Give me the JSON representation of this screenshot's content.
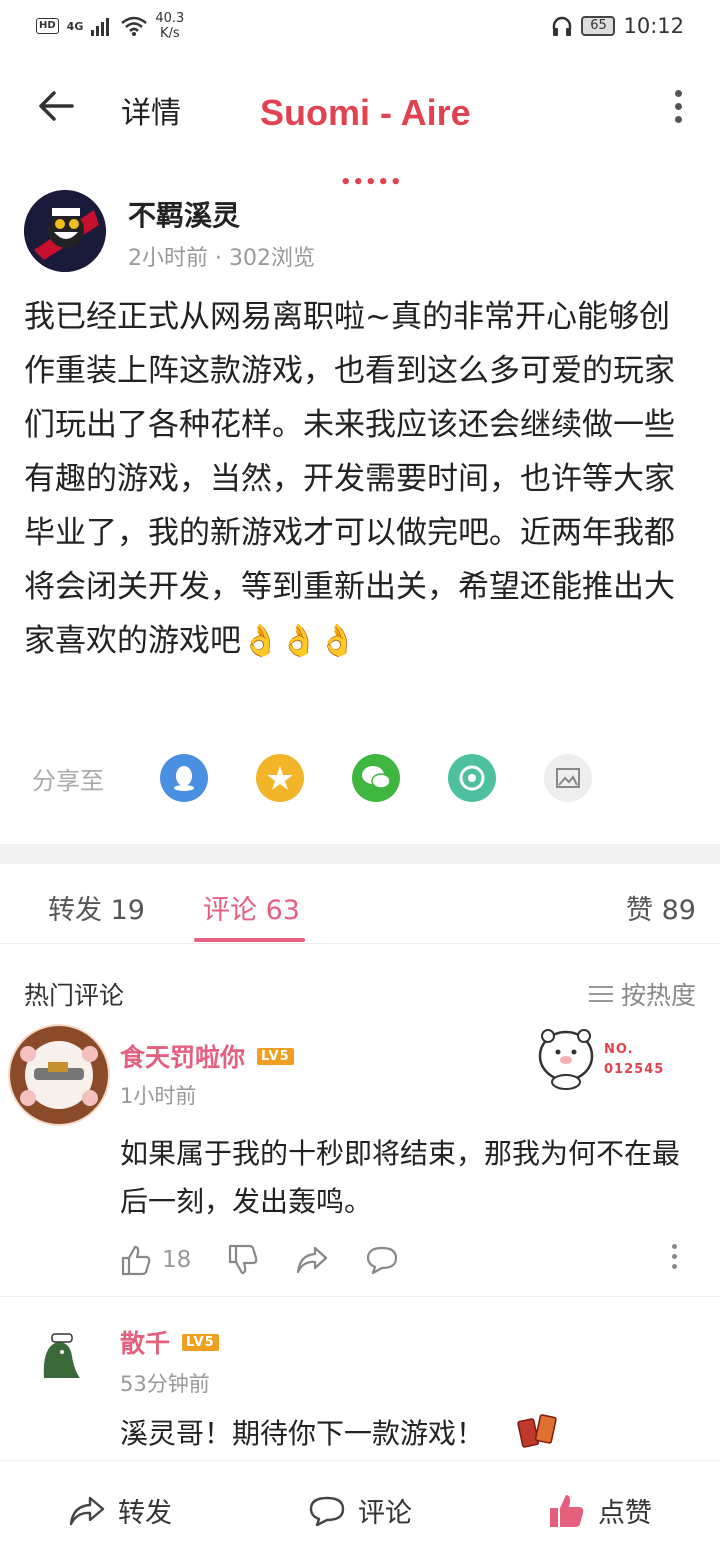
{
  "status_bar": {
    "hd": "HD",
    "signal": "4G",
    "speed_value": "40.3",
    "speed_unit": "K/s",
    "battery": "65",
    "time": "10:12"
  },
  "header": {
    "title": "详情",
    "watermark": "Suomi - Aire",
    "dots": "•••••"
  },
  "post": {
    "author": "不羁溪灵",
    "time": "2小时前",
    "separator": "·",
    "views": "302浏览",
    "content": "我已经正式从网易离职啦~真的非常开心能够创作重装上阵这款游戏，也看到这么多可爱的玩家们玩出了各种花样。未来我应该还会继续做一些有趣的游戏，当然，开发需要时间，也许等大家毕业了，我的新游戏才可以做完吧。近两年我都将会闭关开发，等到重新出关，希望还能推出大家喜欢的游戏吧👌👌👌"
  },
  "share": {
    "label": "分享至",
    "targets": [
      {
        "name": "qq",
        "color": "#4a90e2"
      },
      {
        "name": "qzone",
        "color": "#f2b52a"
      },
      {
        "name": "wechat",
        "color": "#3fb63f"
      },
      {
        "name": "moments",
        "color": "#4ec0a0"
      },
      {
        "name": "save-image",
        "color": "#eeeeee"
      }
    ]
  },
  "tabs": {
    "repost": "转发 19",
    "comments": "评论 63",
    "likes": "赞 89"
  },
  "comments_section": {
    "hot_label": "热门评论",
    "sort_label": "按热度"
  },
  "comments": [
    {
      "user": "食天罚啦你",
      "level": "LV5",
      "time": "1小时前",
      "text": "如果属于我的十秒即将结束，那我为何不在最后一刻，发出轰鸣。",
      "likes": "18",
      "badge_no": "NO.",
      "badge_num": "012545"
    },
    {
      "user": "散千",
      "level": "LV5",
      "time": "53分钟前",
      "text": "溪灵哥！期待你下一款游戏！"
    }
  ],
  "bottom_bar": {
    "repost": "转发",
    "comment": "评论",
    "like": "点赞"
  }
}
